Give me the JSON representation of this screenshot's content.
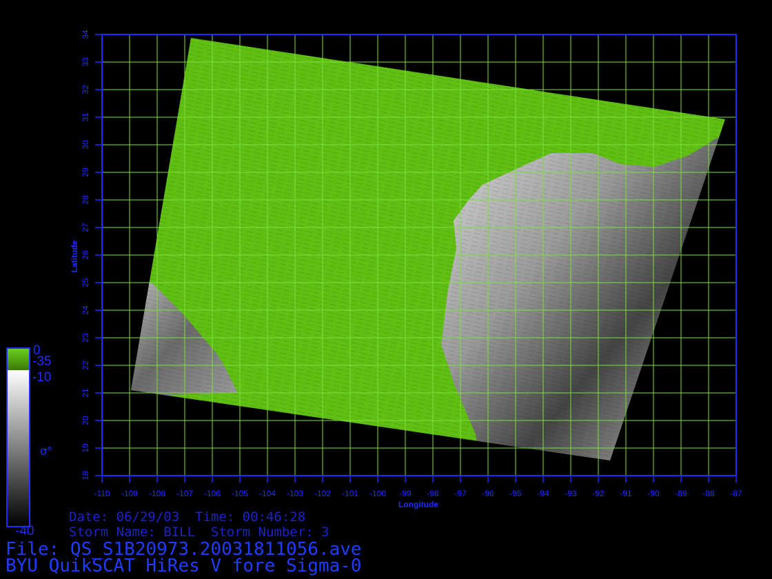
{
  "map": {
    "xlabel": "Longitude",
    "ylabel": "Latitude",
    "lon_range": [
      -110,
      -87
    ],
    "lat_range": [
      18,
      34
    ],
    "lon_ticks": [
      -110,
      -109,
      -108,
      -107,
      -106,
      -105,
      -104,
      -103,
      -102,
      -101,
      -100,
      -99,
      -98,
      -97,
      -96,
      -95,
      -94,
      -93,
      -92,
      -91,
      -90,
      -89,
      -88,
      -87
    ],
    "lat_ticks": [
      18,
      19,
      20,
      21,
      22,
      23,
      24,
      25,
      26,
      27,
      28,
      29,
      30,
      31,
      32,
      33,
      34
    ],
    "grid": true,
    "colors": {
      "frame": "#1e2cff",
      "grid": "#7ee03a",
      "land": "#5fbf12",
      "tick_labels": "#1e2cff"
    }
  },
  "colorbar": {
    "land_top": "0",
    "land_bottom": "-35",
    "ocean_top": "-10",
    "ocean_bottom": "-40",
    "symbol": "σ°"
  },
  "footer": {
    "date_line": "Date: 06/29/03  Time: 00:46:28",
    "storm_line": "Storm Name: BILL  Storm Number: 3",
    "file_line": "File: QS_S1B20973.20031811056.ave",
    "product_line": "BYU QuikSCAT HiRes V fore Sigma-0"
  }
}
